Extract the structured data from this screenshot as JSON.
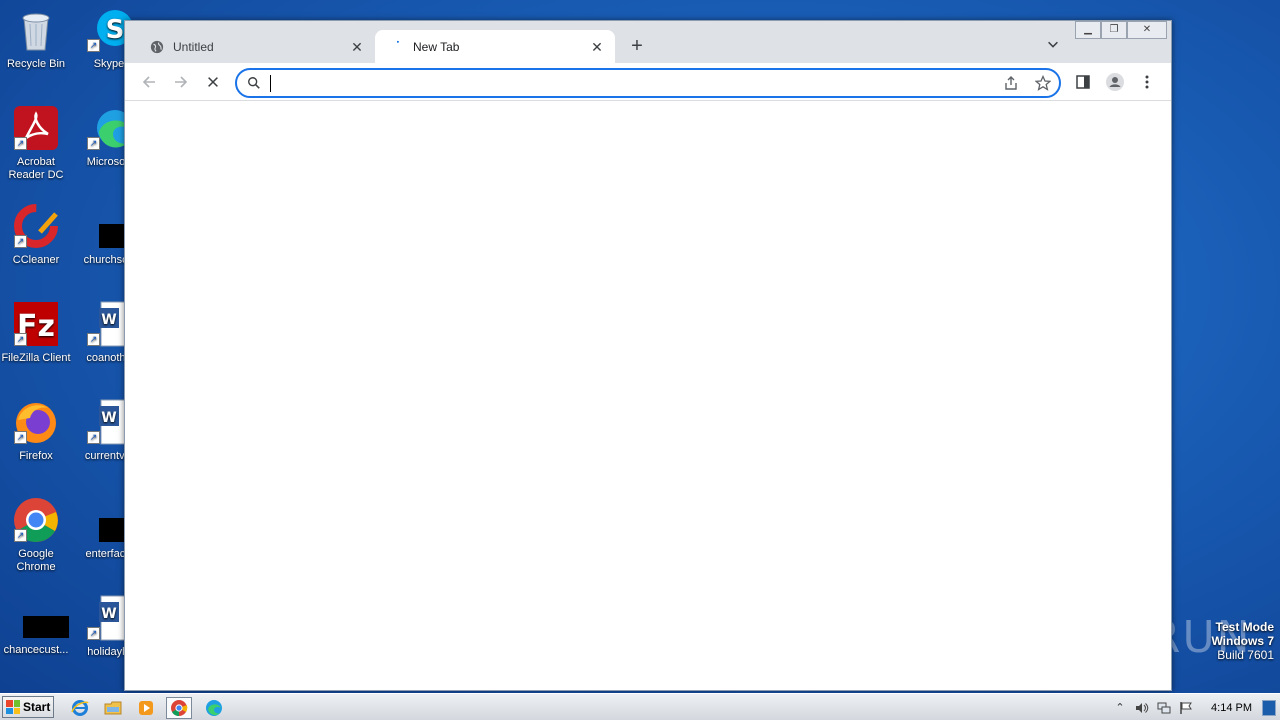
{
  "desktop": {
    "icons": [
      {
        "label": "Recycle Bin"
      },
      {
        "label": "Skype"
      },
      {
        "label": "Acrobat Reader DC"
      },
      {
        "label": "Microsoft"
      },
      {
        "label": "CCleaner"
      },
      {
        "label": "churchsou"
      },
      {
        "label": "FileZilla Client"
      },
      {
        "label": "coanothe"
      },
      {
        "label": "Firefox"
      },
      {
        "label": "currentvie"
      },
      {
        "label": "Google Chrome"
      },
      {
        "label": "enterfacili"
      },
      {
        "label": "chancecust..."
      },
      {
        "label": "holidaylo"
      }
    ],
    "watermark": {
      "line1": "Test Mode",
      "line2": "Windows 7",
      "line3": "Build 7601"
    },
    "brand": "ANY RUN"
  },
  "browser": {
    "tabs": [
      {
        "title": "Untitled",
        "icon": "globe-icon",
        "active": false
      },
      {
        "title": "New Tab",
        "icon": "loading-icon",
        "active": true
      }
    ],
    "omnibox": {
      "value": "",
      "placeholder": ""
    },
    "accent_color": "#1a73e8"
  },
  "taskbar": {
    "start_label": "Start",
    "apps": [
      "internet-explorer-icon",
      "windows-explorer-icon",
      "media-player-icon",
      "chrome-icon",
      "edge-icon"
    ],
    "clock": "4:14 PM"
  }
}
